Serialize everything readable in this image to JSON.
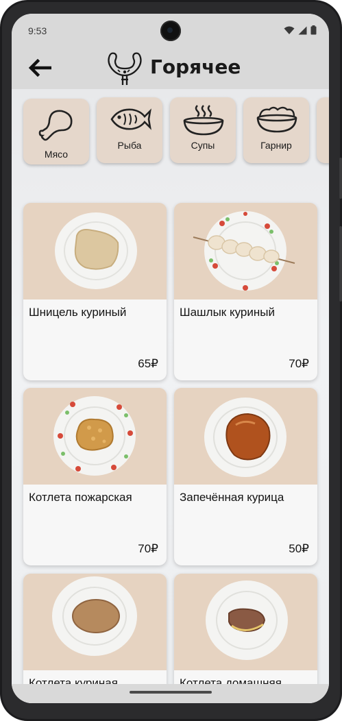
{
  "status": {
    "time": "9:53"
  },
  "header": {
    "title": "Горячее"
  },
  "categories": [
    {
      "label": "Мясо",
      "icon": "chicken-leg-icon"
    },
    {
      "label": "Рыба",
      "icon": "fish-icon"
    },
    {
      "label": "Супы",
      "icon": "soup-bowl-icon"
    },
    {
      "label": "Гарнир",
      "icon": "garnish-bowl-icon"
    }
  ],
  "dishes": [
    {
      "name": "Шницель куриный",
      "price": "65₽"
    },
    {
      "name": "Шашлык куриный",
      "price": "70₽"
    },
    {
      "name": "Котлета пожарская",
      "price": "70₽"
    },
    {
      "name": "Запечённая курица",
      "price": "50₽"
    },
    {
      "name": "Котлета куриная",
      "price": ""
    },
    {
      "name": "Котлета домашняя",
      "price": ""
    }
  ]
}
